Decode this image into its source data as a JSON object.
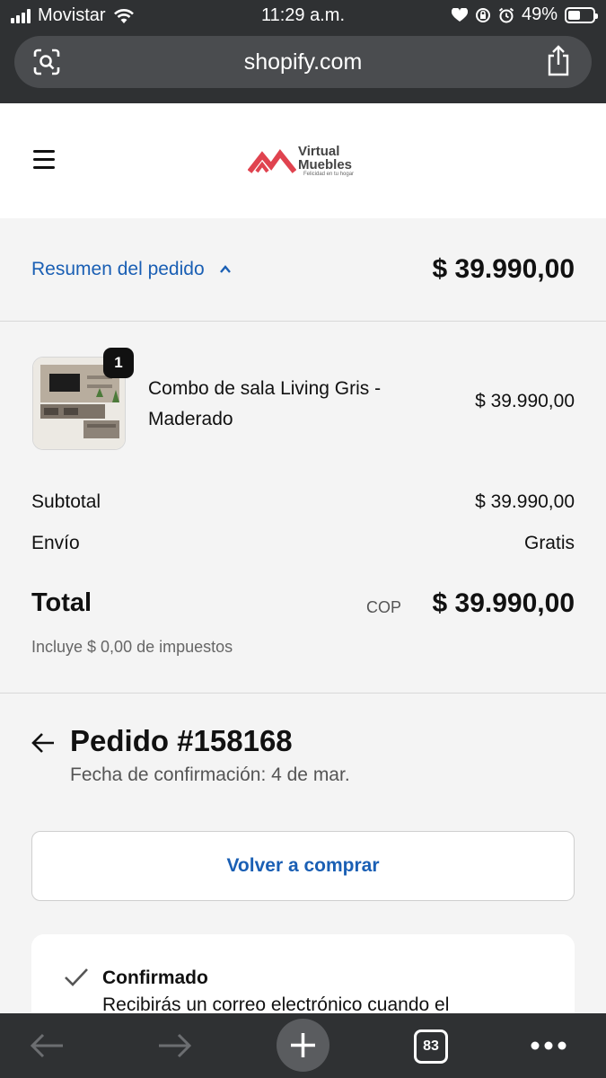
{
  "status_bar": {
    "carrier": "Movistar",
    "time": "11:29 a.m.",
    "battery": "49%",
    "battery_level": 0.49
  },
  "browser": {
    "url": "shopify.com",
    "tab_count": "83"
  },
  "store": {
    "logo_line1": "Virtual",
    "logo_line2": "Muebles",
    "logo_tagline": "Felicidad en tu hogar",
    "brand_color": "#e0434f"
  },
  "summary": {
    "toggle_label": "Resumen del pedido",
    "total": "$ 39.990,00",
    "link_color": "#1a5fb4"
  },
  "line_item": {
    "quantity": "1",
    "name": "Combo de sala Living Gris - Maderado",
    "price": "$ 39.990,00"
  },
  "totals": {
    "subtotal_label": "Subtotal",
    "subtotal_value": "$ 39.990,00",
    "shipping_label": "Envío",
    "shipping_value": "Gratis",
    "total_label": "Total",
    "currency": "COP",
    "total_value": "$ 39.990,00",
    "taxes_note": "Incluye $ 0,00 de impuestos"
  },
  "order": {
    "title": "Pedido #158168",
    "date": "Fecha de confirmación: 4 de mar.",
    "reorder_label": "Volver a comprar"
  },
  "status": {
    "title": "Confirmado",
    "description": "Recibirás un correo electrónico cuando el"
  }
}
